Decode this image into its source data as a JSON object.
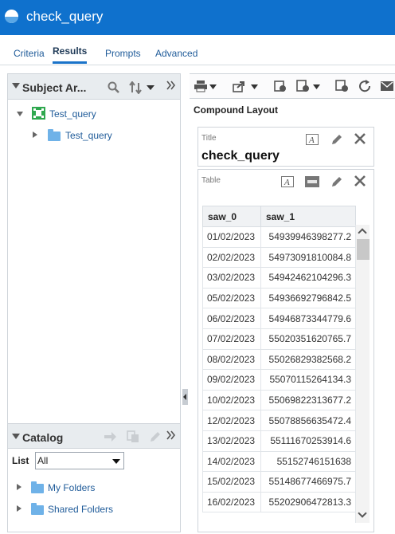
{
  "app": {
    "title": "check_query"
  },
  "tabs": [
    {
      "label": "Criteria"
    },
    {
      "label": "Results"
    },
    {
      "label": "Prompts"
    },
    {
      "label": "Advanced"
    }
  ],
  "subject_area": {
    "header": "Subject Ar...",
    "tree": [
      {
        "label": "Test_query",
        "expanded": true,
        "icon": "subject-area-icon"
      },
      {
        "label": "Test_query",
        "expanded": false,
        "icon": "folder-icon"
      }
    ]
  },
  "catalog": {
    "header": "Catalog",
    "list_label": "List",
    "list_value": "All",
    "items": [
      {
        "label": "My Folders"
      },
      {
        "label": "Shared Folders"
      }
    ]
  },
  "results": {
    "compound_layout": "Compound Layout",
    "title_view": {
      "label": "Title",
      "text": "check_query"
    },
    "table_view": {
      "label": "Table"
    }
  },
  "table": {
    "columns": [
      "saw_0",
      "saw_1"
    ],
    "rows": [
      [
        "01/02/2023",
        "54939946398277.2"
      ],
      [
        "02/02/2023",
        "54973091810084.8"
      ],
      [
        "03/02/2023",
        "54942462104296.3"
      ],
      [
        "05/02/2023",
        "54936692796842.5"
      ],
      [
        "06/02/2023",
        "54946873344779.6"
      ],
      [
        "07/02/2023",
        "55020351620765.7"
      ],
      [
        "08/02/2023",
        "55026829382568.2"
      ],
      [
        "09/02/2023",
        "55070115264134.3"
      ],
      [
        "10/02/2023",
        "55069822313677.2"
      ],
      [
        "12/02/2023",
        "55078856635472.4"
      ],
      [
        "13/02/2023",
        "55111670253914.6"
      ],
      [
        "14/02/2023",
        "55152746151638"
      ],
      [
        "15/02/2023",
        "55148677466975.7"
      ],
      [
        "16/02/2023",
        "55202906472813.3"
      ]
    ]
  },
  "colors": {
    "titlebar": "#0f71cd",
    "accent": "#1a73c9",
    "link": "#1f5b99",
    "panel_header": "#e8ecef",
    "folder": "#6fb2e8",
    "subject_area_icon": "#2fa84f"
  },
  "icons": {
    "subject_area_toolbar": [
      "search-icon",
      "sort-icon",
      "chevron-down-icon",
      "expand-panel-icon"
    ],
    "catalog_toolbar": [
      "move-icon",
      "copy-icon",
      "edit-icon",
      "expand-panel-icon"
    ],
    "results_toolbar": [
      "print-icon",
      "export-icon",
      "schedule-icon",
      "deliver-icon",
      "refresh-icon",
      "email-icon"
    ],
    "view_tools": [
      "format-text-icon",
      "rename-icon",
      "edit-icon",
      "close-icon"
    ]
  }
}
